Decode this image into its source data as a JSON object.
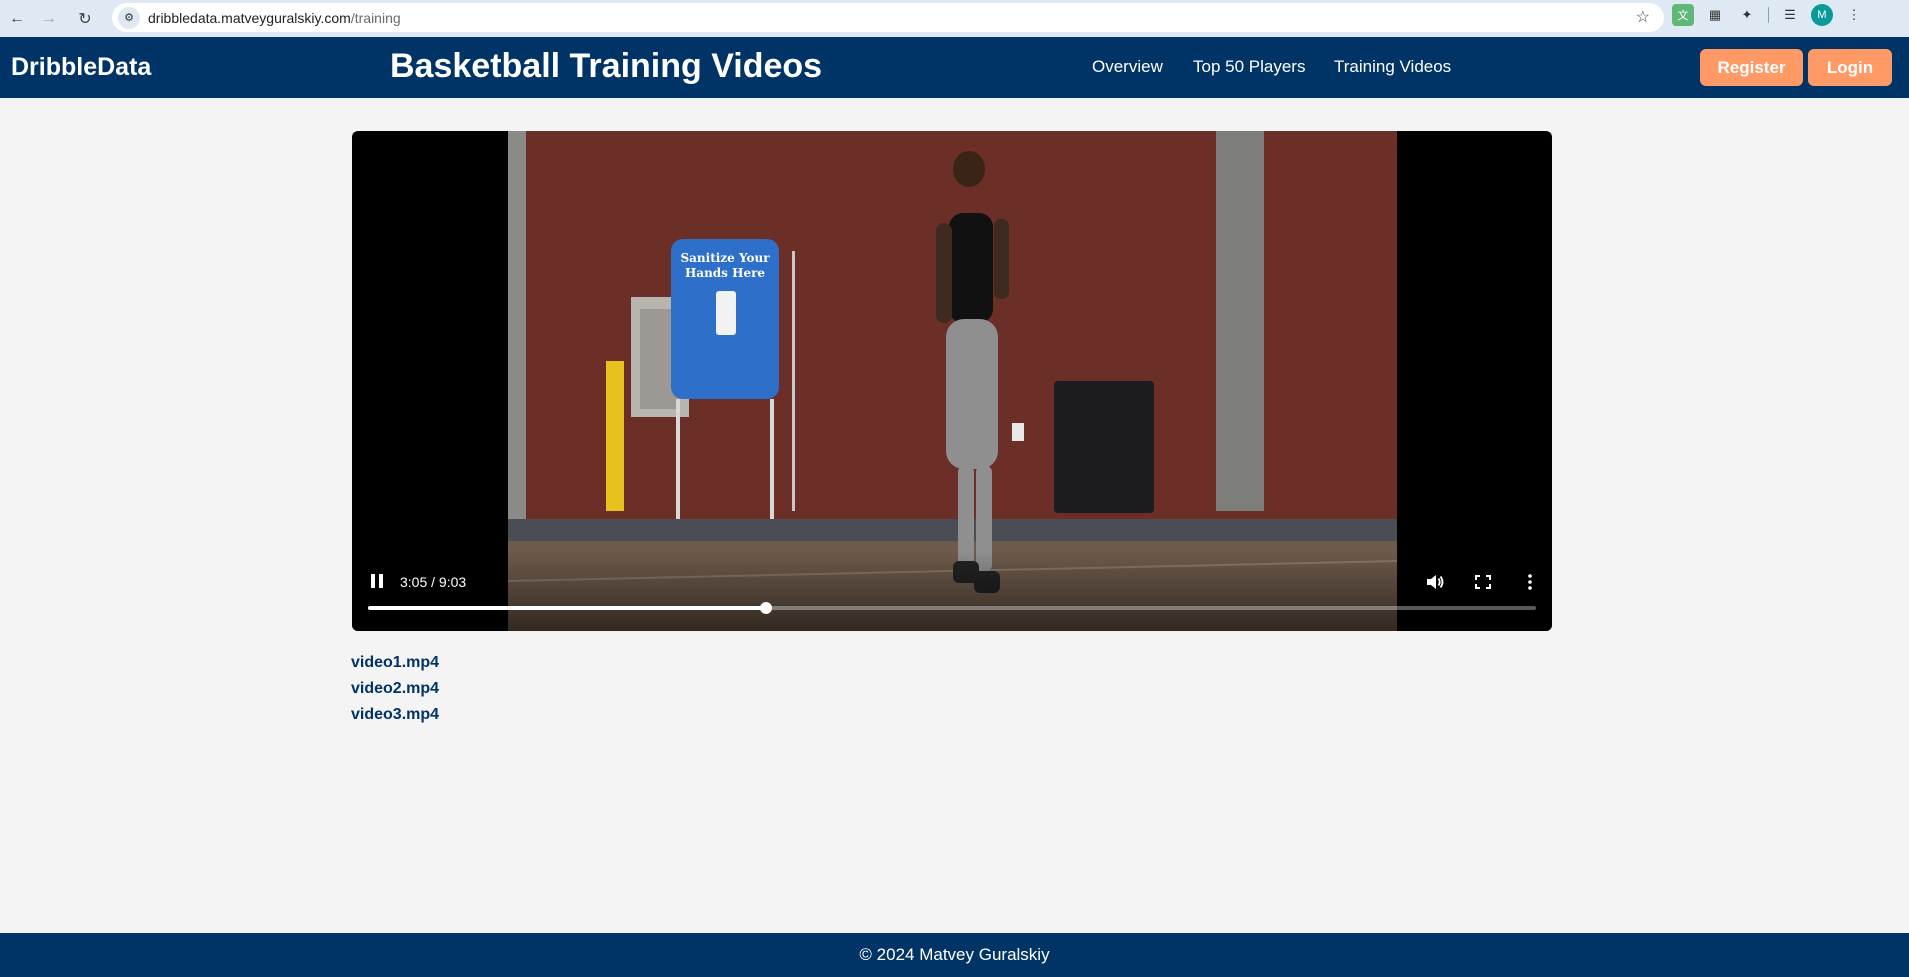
{
  "browser": {
    "url_host": "dribbledata.matveyguralskiy.com",
    "url_path": "/training",
    "profile_initial": "M"
  },
  "site": {
    "logo": "DribbleData",
    "title": "Basketball Training Videos",
    "nav": [
      "Overview",
      "Top 50 Players",
      "Training Videos"
    ],
    "register_label": "Register",
    "login_label": "Login",
    "accent_color": "#ff9966",
    "brand_color": "#003366"
  },
  "player": {
    "time_display": "3:05 / 9:03",
    "progress_fraction": 0.3407,
    "frame_sign_line1": "Sanitize Your",
    "frame_sign_line2": "Hands Here"
  },
  "videos": [
    "video1.mp4",
    "video2.mp4",
    "video3.mp4"
  ],
  "footer": {
    "text": "© 2024 Matvey Guralskiy"
  }
}
